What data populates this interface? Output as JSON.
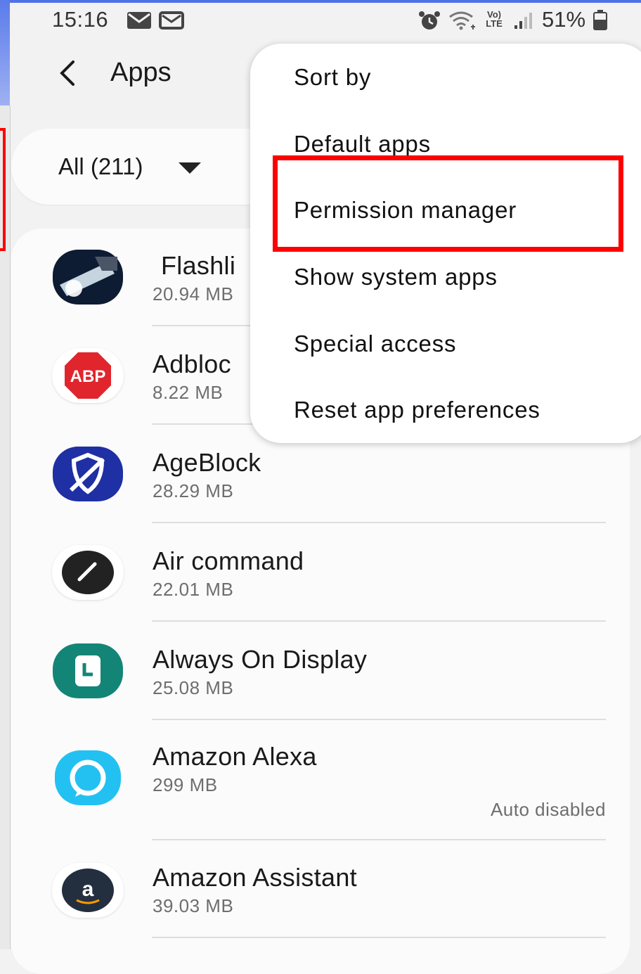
{
  "status_bar": {
    "time": "15:16",
    "battery_text": "51%"
  },
  "header": {
    "title": "Apps"
  },
  "filter": {
    "label": "All (211)"
  },
  "menu": {
    "items": [
      {
        "label": "Sort by"
      },
      {
        "label": "Default apps"
      },
      {
        "label": "Permission manager"
      },
      {
        "label": "Show system apps"
      },
      {
        "label": "Special access"
      },
      {
        "label": "Reset app preferences"
      }
    ],
    "highlighted_item": "Permission manager",
    "highlight_color": "#ff0000"
  },
  "apps": [
    {
      "name": "Flashli",
      "size": "20.94 MB",
      "icon": "flashlight-icon",
      "note": ""
    },
    {
      "name": "Adbloc",
      "size": "8.22 MB",
      "icon": "adblock-abp-icon",
      "note": ""
    },
    {
      "name": "AgeBlock",
      "size": "28.29 MB",
      "icon": "ageblock-shield-icon",
      "note": ""
    },
    {
      "name": "Air command",
      "size": "22.01 MB",
      "icon": "pen-icon",
      "note": ""
    },
    {
      "name": "Always On Display",
      "size": "25.08 MB",
      "icon": "clock-icon",
      "note": ""
    },
    {
      "name": "Amazon Alexa",
      "size": "299 MB",
      "icon": "alexa-icon",
      "note": "Auto disabled"
    },
    {
      "name": "Amazon Assistant",
      "size": "39.03 MB",
      "icon": "amazon-icon",
      "note": ""
    }
  ],
  "colors": {
    "accent_red": "#ff0000",
    "frame_blue": "#4f72e8",
    "abp_red": "#e0252d",
    "ageblock_blue": "#1f2fa4",
    "aod_teal": "#138577",
    "alexa_cyan": "#22c1f1"
  }
}
